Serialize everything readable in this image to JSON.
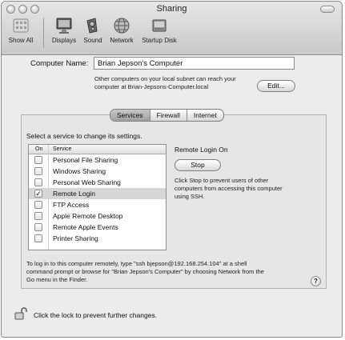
{
  "window": {
    "title": "Sharing"
  },
  "toolbar": {
    "show_all": "Show All",
    "items": [
      {
        "label": "Displays",
        "icon": "display-icon"
      },
      {
        "label": "Sound",
        "icon": "speaker-icon"
      },
      {
        "label": "Network",
        "icon": "network-globe-icon"
      },
      {
        "label": "Startup Disk",
        "icon": "startup-disk-icon"
      }
    ]
  },
  "computer": {
    "label": "Computer Name:",
    "value": "Brian Jepson's Computer",
    "note_line1": "Other computers on your local subnet can reach your",
    "note_line2": "computer at Brian-Jepsons-Computer.local",
    "edit_button": "Edit..."
  },
  "tabs": [
    {
      "label": "Services",
      "active": true
    },
    {
      "label": "Firewall",
      "active": false
    },
    {
      "label": "Internet",
      "active": false
    }
  ],
  "services": {
    "instruction": "Select a service to change its settings.",
    "col_on": "On",
    "col_service": "Service",
    "rows": [
      {
        "name": "Personal File Sharing",
        "on": false,
        "selected": false
      },
      {
        "name": "Windows Sharing",
        "on": false,
        "selected": false
      },
      {
        "name": "Personal Web Sharing",
        "on": false,
        "selected": false
      },
      {
        "name": "Remote Login",
        "on": true,
        "selected": true
      },
      {
        "name": "FTP Access",
        "on": false,
        "selected": false
      },
      {
        "name": "Apple Remote Desktop",
        "on": false,
        "selected": false
      },
      {
        "name": "Remote Apple Events",
        "on": false,
        "selected": false
      },
      {
        "name": "Printer Sharing",
        "on": false,
        "selected": false
      }
    ]
  },
  "detail": {
    "status": "Remote Login On",
    "stop_button": "Stop",
    "desc_line1": "Click Stop to prevent users of other",
    "desc_line2": "computers from accessing this computer",
    "desc_line3": "using SSH."
  },
  "footer": {
    "info_line1": "To log in to this computer remotely, type \"ssh bjepson@192.168.254.104\" at a shell",
    "info_line2": "command prompt or browse for \"Brian Jepson's Computer\" by choosing Network from the",
    "info_line3": "Go menu in the Finder.",
    "help": "?",
    "lock_text": "Click the lock to prevent further changes."
  }
}
